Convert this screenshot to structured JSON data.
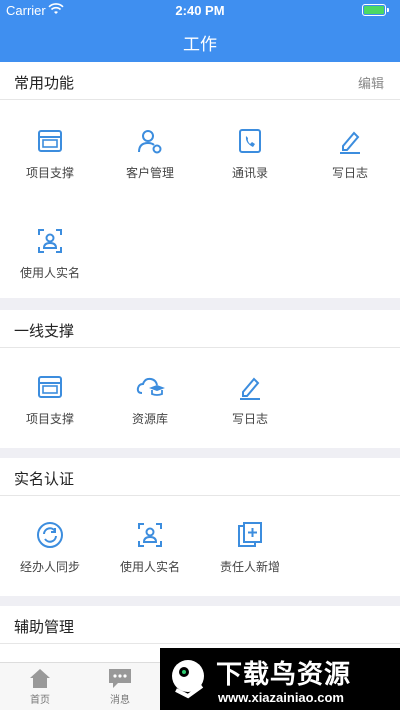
{
  "status_bar": {
    "carrier": "Carrier",
    "time": "2:40 PM"
  },
  "header": {
    "title": "工作"
  },
  "sections": [
    {
      "title": "常用功能",
      "action": "编辑",
      "items": [
        {
          "label": "项目支撑",
          "icon": "project-support-icon"
        },
        {
          "label": "客户管理",
          "icon": "customer-management-icon"
        },
        {
          "label": "通讯录",
          "icon": "contacts-icon"
        },
        {
          "label": "写日志",
          "icon": "write-log-icon"
        },
        {
          "label": "使用人实名",
          "icon": "user-verify-icon"
        }
      ]
    },
    {
      "title": "一线支撑",
      "items": [
        {
          "label": "项目支撑",
          "icon": "project-support-icon"
        },
        {
          "label": "资源库",
          "icon": "resource-library-icon"
        },
        {
          "label": "写日志",
          "icon": "write-log-icon"
        }
      ]
    },
    {
      "title": "实名认证",
      "items": [
        {
          "label": "经办人同步",
          "icon": "sync-icon"
        },
        {
          "label": "使用人实名",
          "icon": "user-verify-icon"
        },
        {
          "label": "责任人新增",
          "icon": "add-responsible-icon"
        }
      ]
    },
    {
      "title": "辅助管理",
      "items": []
    }
  ],
  "tab_bar": {
    "items": [
      {
        "label": "首页",
        "icon": "home-icon"
      },
      {
        "label": "消息",
        "icon": "message-icon"
      }
    ]
  },
  "watermark": {
    "text": "下载鸟资源",
    "site": "www.xiazainiao.com"
  },
  "colors": {
    "header": "#3f8ff0",
    "icon": "#3c8dde"
  }
}
